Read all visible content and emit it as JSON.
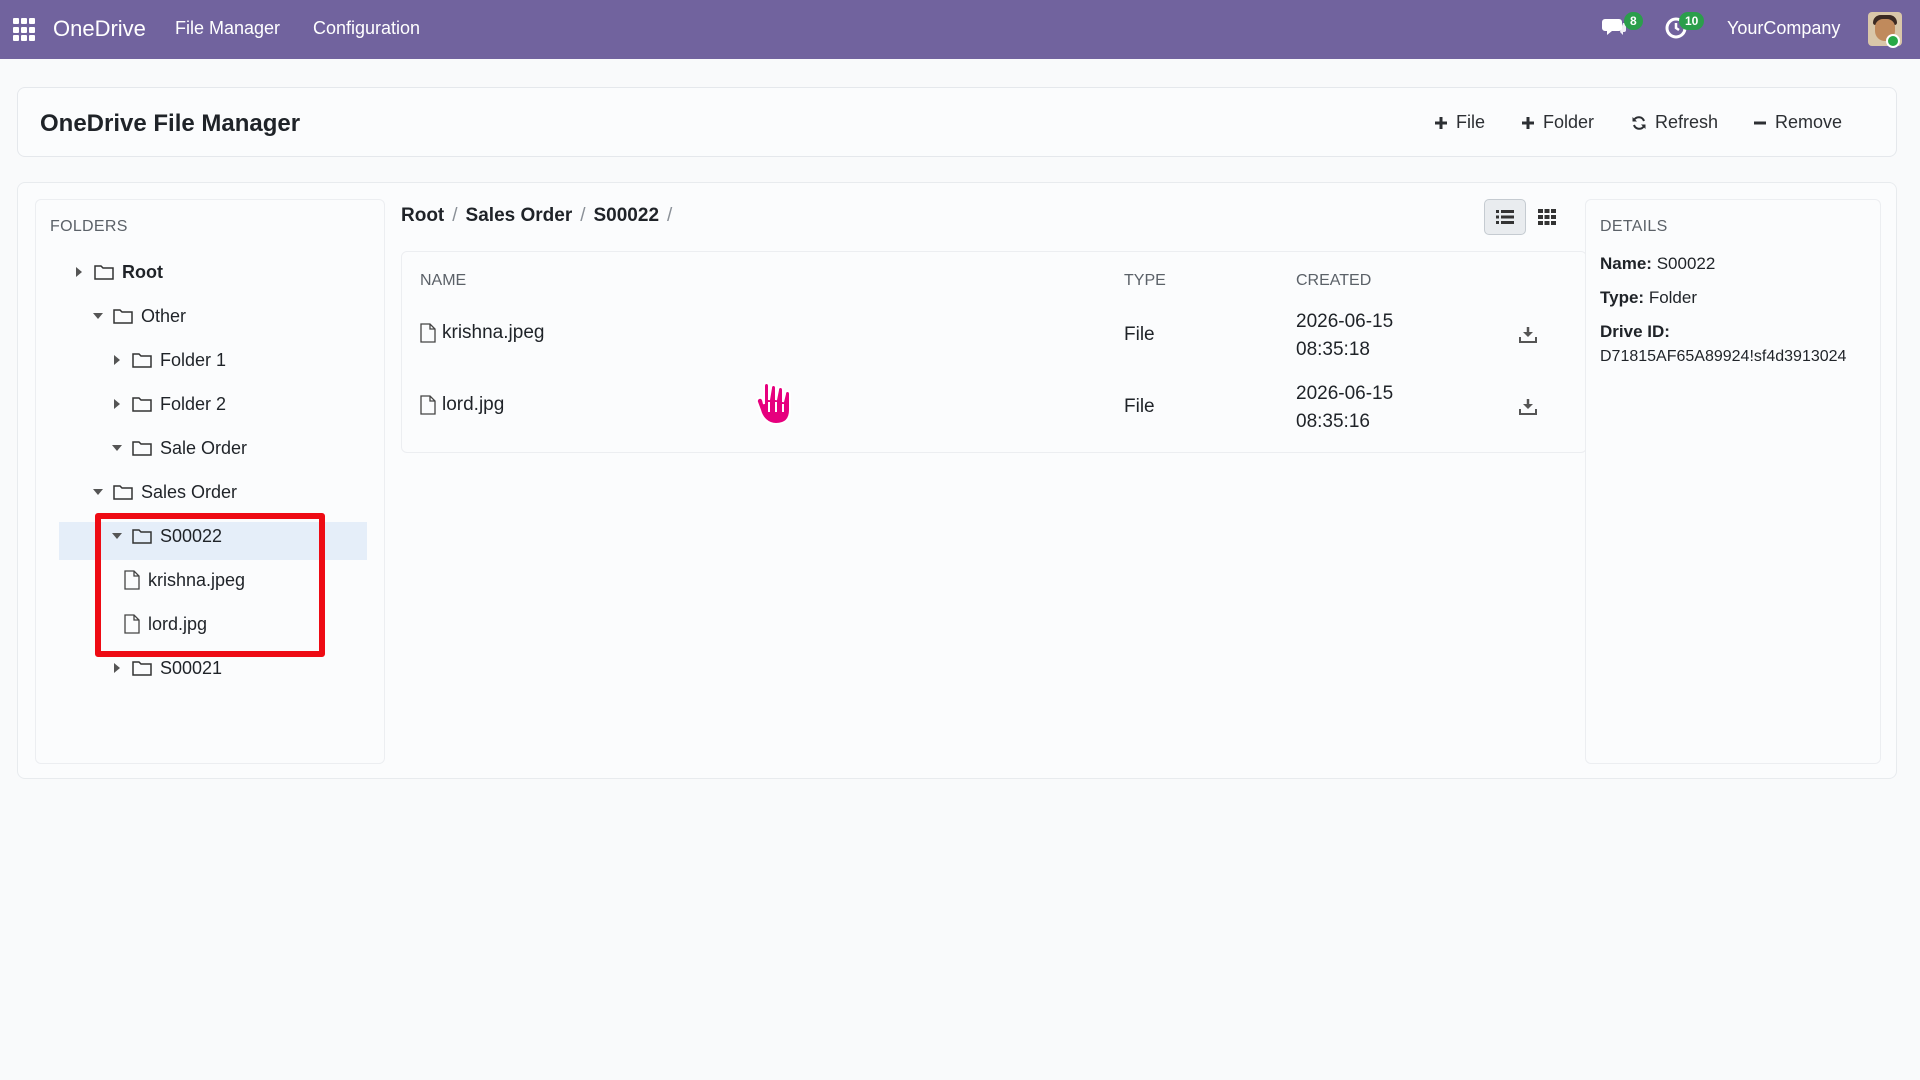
{
  "navbar": {
    "brand": "OneDrive",
    "menu": [
      "File Manager",
      "Configuration"
    ],
    "messages_count": "8",
    "activities_count": "10",
    "company": "YourCompany"
  },
  "control_panel": {
    "title": "OneDrive File Manager",
    "buttons": {
      "add_file": "File",
      "add_folder": "Folder",
      "refresh": "Refresh",
      "remove": "Remove"
    }
  },
  "folders": {
    "title": "FOLDERS",
    "tree": [
      {
        "label": "Root",
        "expanded": false
      },
      {
        "label": "Other",
        "expanded": true
      },
      {
        "label": "Folder 1",
        "expanded": false
      },
      {
        "label": "Folder 2",
        "expanded": false
      },
      {
        "label": "Sale Order",
        "expanded": true
      },
      {
        "label": "Sales Order",
        "expanded": true
      },
      {
        "label": "S00022",
        "expanded": true,
        "selected": true
      },
      {
        "label": "krishna.jpeg",
        "type": "file"
      },
      {
        "label": "lord.jpg",
        "type": "file"
      },
      {
        "label": "S00021",
        "expanded": false
      }
    ]
  },
  "breadcrumb": [
    "Root",
    "Sales Order",
    "S00022"
  ],
  "breadcrumb_sep": "/",
  "table": {
    "columns": {
      "name": "NAME",
      "type": "TYPE",
      "created": "CREATED"
    },
    "rows": [
      {
        "name": "krishna.jpeg",
        "type": "File",
        "created_date": "2026-06-15",
        "created_time": "08:35:18"
      },
      {
        "name": "lord.jpg",
        "type": "File",
        "created_date": "2026-06-15",
        "created_time": "08:35:16"
      }
    ]
  },
  "details": {
    "title": "DETAILS",
    "name_label": "Name:",
    "name_value": "S00022",
    "type_label": "Type:",
    "type_value": "Folder",
    "drive_id_label": "Drive ID:",
    "drive_id_value": "D71815AF65A89924!sf4d3913024"
  },
  "colors": {
    "navbar": "#71639e",
    "badge": "#2b9e4b",
    "highlight": "#ee0b14",
    "cursor": "#e6007e"
  }
}
